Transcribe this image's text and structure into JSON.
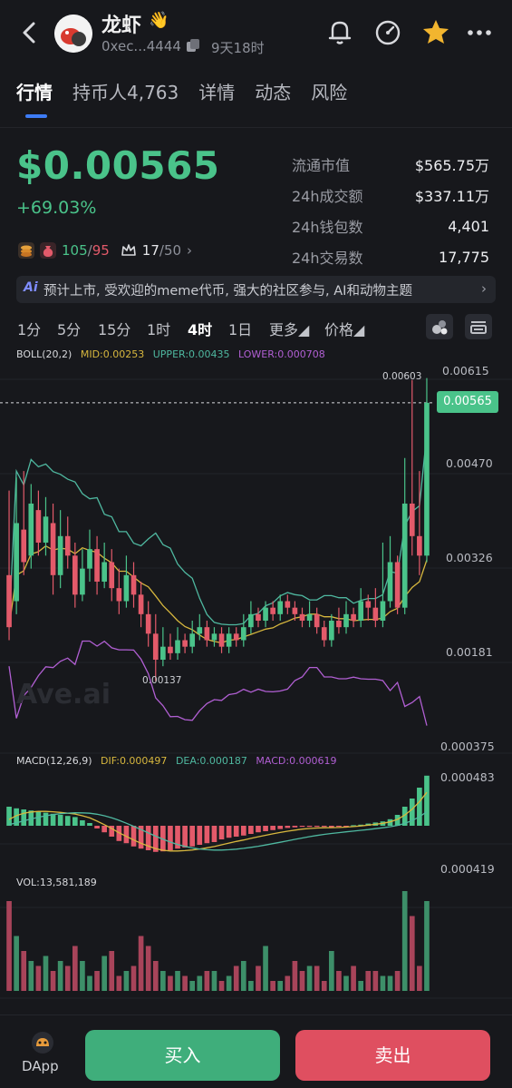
{
  "header": {
    "token_name": "龙虾",
    "wave_emoji": "👋",
    "address": "0xec...4444",
    "age": "9天18时",
    "icons": [
      "back-arrow-icon",
      "bell-icon",
      "speedometer-icon",
      "star-icon",
      "more-icon"
    ]
  },
  "tabs": [
    {
      "label": "行情",
      "active": true
    },
    {
      "label": "持币人4,763",
      "active": false
    },
    {
      "label": "详情",
      "active": false
    },
    {
      "label": "动态",
      "active": false
    },
    {
      "label": "风险",
      "active": false
    }
  ],
  "price": {
    "value": "$0.00565",
    "change": "+69.03%"
  },
  "stats": [
    {
      "label": "流通市值",
      "value": "$565.75万"
    },
    {
      "label": "24h成交额",
      "value": "$337.11万"
    },
    {
      "label": "24h钱包数",
      "value": "4,401"
    },
    {
      "label": "24h交易数",
      "value": "17,775"
    }
  ],
  "badges": {
    "bag_green": "105",
    "slash": "/",
    "bag_red": "95",
    "crown_value": "17",
    "crown_total": "/50",
    "chevron": "›"
  },
  "notice": {
    "ai_label": "Ai",
    "text": "预计上市, 受欢迎的meme代币, 强大的社区参与, AI和动物主题",
    "arrow": "›"
  },
  "timeframes": [
    {
      "label": "1分",
      "active": false
    },
    {
      "label": "5分",
      "active": false
    },
    {
      "label": "15分",
      "active": false
    },
    {
      "label": "1时",
      "active": false
    },
    {
      "label": "4时",
      "active": true
    },
    {
      "label": "1日",
      "active": false
    },
    {
      "label": "更多◢",
      "active": false
    },
    {
      "label": "价格◢",
      "active": false
    }
  ],
  "boll_legend": {
    "name": "BOLL(20,2)",
    "mid": "MID:0.00253",
    "upper": "UPPER:0.00435",
    "lower": "LOWER:0.000708"
  },
  "price_axis": [
    "0.00615",
    "0.00565",
    "0.00470",
    "0.00326",
    "0.00181",
    "0.000375"
  ],
  "low_label": "0.00137",
  "high_label": "0.00603",
  "watermark": "Ave.ai",
  "macd_legend": {
    "name": "MACD(12,26,9)",
    "dif": "DIF:0.000497",
    "dea": "DEA:0.000187",
    "macd": "MACD:0.000619"
  },
  "macd_axis": [
    "0.000483",
    "0.000419"
  ],
  "vol_legend": "VOL:13,581,189",
  "colors": {
    "up": "#4ac38a",
    "down": "#e35a6a",
    "mid": "#d7b73e",
    "upper": "#4fb8a0",
    "lower": "#b15fd3",
    "accent": "#3d7cf5"
  },
  "bottom": {
    "dapp_label": "DApp",
    "buy_label": "买入",
    "sell_label": "卖出"
  },
  "chart_data": {
    "type": "candlestick",
    "title": "",
    "ylim": [
      0.000375,
      0.00615
    ],
    "candles": [
      {
        "o": 0.003,
        "c": 0.0022,
        "h": 0.0043,
        "l": 0.002
      },
      {
        "o": 0.0026,
        "c": 0.0038,
        "h": 0.0045,
        "l": 0.0024
      },
      {
        "o": 0.0037,
        "c": 0.0032,
        "h": 0.0046,
        "l": 0.003
      },
      {
        "o": 0.0033,
        "c": 0.0041,
        "h": 0.0044,
        "l": 0.0031
      },
      {
        "o": 0.004,
        "c": 0.0035,
        "h": 0.0043,
        "l": 0.0033
      },
      {
        "o": 0.0035,
        "c": 0.0039,
        "h": 0.0042,
        "l": 0.0033
      },
      {
        "o": 0.0038,
        "c": 0.003,
        "h": 0.0041,
        "l": 0.0027
      },
      {
        "o": 0.003,
        "c": 0.0036,
        "h": 0.004,
        "l": 0.0028
      },
      {
        "o": 0.0036,
        "c": 0.0033,
        "h": 0.0039,
        "l": 0.0031
      },
      {
        "o": 0.0033,
        "c": 0.0027,
        "h": 0.0035,
        "l": 0.0025
      },
      {
        "o": 0.0027,
        "c": 0.0031,
        "h": 0.0034,
        "l": 0.0026
      },
      {
        "o": 0.0031,
        "c": 0.0034,
        "h": 0.0037,
        "l": 0.0029
      },
      {
        "o": 0.0034,
        "c": 0.0029,
        "h": 0.0036,
        "l": 0.0027
      },
      {
        "o": 0.0029,
        "c": 0.0032,
        "h": 0.0035,
        "l": 0.0028
      },
      {
        "o": 0.0032,
        "c": 0.0028,
        "h": 0.0034,
        "l": 0.0026
      },
      {
        "o": 0.0028,
        "c": 0.0026,
        "h": 0.0031,
        "l": 0.0024
      },
      {
        "o": 0.0026,
        "c": 0.003,
        "h": 0.0033,
        "l": 0.0025
      },
      {
        "o": 0.003,
        "c": 0.0027,
        "h": 0.0032,
        "l": 0.0025
      },
      {
        "o": 0.0027,
        "c": 0.0024,
        "h": 0.0029,
        "l": 0.0022
      },
      {
        "o": 0.0024,
        "c": 0.0021,
        "h": 0.0026,
        "l": 0.0019
      },
      {
        "o": 0.0021,
        "c": 0.0017,
        "h": 0.0024,
        "l": 0.00137
      },
      {
        "o": 0.0017,
        "c": 0.0019,
        "h": 0.0022,
        "l": 0.0016
      },
      {
        "o": 0.0019,
        "c": 0.0018,
        "h": 0.0021,
        "l": 0.0017
      },
      {
        "o": 0.0018,
        "c": 0.002,
        "h": 0.0022,
        "l": 0.0017
      },
      {
        "o": 0.002,
        "c": 0.0019,
        "h": 0.0021,
        "l": 0.0018
      },
      {
        "o": 0.0019,
        "c": 0.0021,
        "h": 0.0023,
        "l": 0.0018
      },
      {
        "o": 0.0021,
        "c": 0.0022,
        "h": 0.0024,
        "l": 0.002
      },
      {
        "o": 0.0022,
        "c": 0.002,
        "h": 0.0023,
        "l": 0.0019
      },
      {
        "o": 0.002,
        "c": 0.0021,
        "h": 0.0022,
        "l": 0.0019
      },
      {
        "o": 0.0021,
        "c": 0.0019,
        "h": 0.0022,
        "l": 0.0018
      },
      {
        "o": 0.0019,
        "c": 0.0021,
        "h": 0.0022,
        "l": 0.0018
      },
      {
        "o": 0.0021,
        "c": 0.002,
        "h": 0.0022,
        "l": 0.0019
      },
      {
        "o": 0.002,
        "c": 0.0022,
        "h": 0.0024,
        "l": 0.0019
      },
      {
        "o": 0.0022,
        "c": 0.0024,
        "h": 0.0026,
        "l": 0.0021
      },
      {
        "o": 0.0024,
        "c": 0.0023,
        "h": 0.0025,
        "l": 0.0022
      },
      {
        "o": 0.0023,
        "c": 0.0025,
        "h": 0.0026,
        "l": 0.0022
      },
      {
        "o": 0.0025,
        "c": 0.0024,
        "h": 0.0026,
        "l": 0.0023
      },
      {
        "o": 0.0024,
        "c": 0.0026,
        "h": 0.0027,
        "l": 0.0023
      },
      {
        "o": 0.0026,
        "c": 0.0025,
        "h": 0.0027,
        "l": 0.0024
      },
      {
        "o": 0.0025,
        "c": 0.0024,
        "h": 0.0026,
        "l": 0.0023
      },
      {
        "o": 0.0024,
        "c": 0.0023,
        "h": 0.0025,
        "l": 0.0022
      },
      {
        "o": 0.0023,
        "c": 0.0024,
        "h": 0.0026,
        "l": 0.0022
      },
      {
        "o": 0.0024,
        "c": 0.0022,
        "h": 0.0025,
        "l": 0.0021
      },
      {
        "o": 0.0022,
        "c": 0.002,
        "h": 0.0023,
        "l": 0.0019
      },
      {
        "o": 0.002,
        "c": 0.0023,
        "h": 0.0024,
        "l": 0.0019
      },
      {
        "o": 0.0023,
        "c": 0.0022,
        "h": 0.0025,
        "l": 0.0021
      },
      {
        "o": 0.0022,
        "c": 0.0024,
        "h": 0.0026,
        "l": 0.0021
      },
      {
        "o": 0.0024,
        "c": 0.0023,
        "h": 0.0025,
        "l": 0.0022
      },
      {
        "o": 0.0023,
        "c": 0.0026,
        "h": 0.0028,
        "l": 0.0022
      },
      {
        "o": 0.0026,
        "c": 0.0025,
        "h": 0.0027,
        "l": 0.0023
      },
      {
        "o": 0.0025,
        "c": 0.0023,
        "h": 0.0028,
        "l": 0.0022
      },
      {
        "o": 0.0023,
        "c": 0.0026,
        "h": 0.0035,
        "l": 0.0022
      },
      {
        "o": 0.0026,
        "c": 0.0032,
        "h": 0.0036,
        "l": 0.0025
      },
      {
        "o": 0.0032,
        "c": 0.0025,
        "h": 0.0033,
        "l": 0.0024
      },
      {
        "o": 0.0025,
        "c": 0.0041,
        "h": 0.0048,
        "l": 0.0024
      },
      {
        "o": 0.0041,
        "c": 0.0036,
        "h": 0.006,
        "l": 0.0033
      },
      {
        "o": 0.0036,
        "c": 0.0033,
        "h": 0.0046,
        "l": 0.003
      },
      {
        "o": 0.0033,
        "c": 0.00565,
        "h": 0.00603,
        "l": 0.0032
      }
    ],
    "volume": [
      0.9,
      0.55,
      0.4,
      0.3,
      0.25,
      0.35,
      0.2,
      0.3,
      0.25,
      0.45,
      0.3,
      0.15,
      0.2,
      0.35,
      0.4,
      0.15,
      0.2,
      0.25,
      0.55,
      0.45,
      0.3,
      0.2,
      0.15,
      0.2,
      0.15,
      0.1,
      0.15,
      0.2,
      0.2,
      0.1,
      0.15,
      0.25,
      0.3,
      0.1,
      0.25,
      0.45,
      0.1,
      0.1,
      0.15,
      0.3,
      0.2,
      0.25,
      0.25,
      0.1,
      0.4,
      0.2,
      0.15,
      0.25,
      0.1,
      0.2,
      0.2,
      0.15,
      0.15,
      0.2,
      1.0,
      0.75,
      0.25,
      0.9
    ],
    "macd_hist": [
      0.35,
      0.32,
      0.3,
      0.28,
      0.26,
      0.24,
      0.22,
      0.2,
      0.18,
      0.16,
      0.1,
      0.05,
      -0.05,
      -0.12,
      -0.2,
      -0.28,
      -0.32,
      -0.38,
      -0.42,
      -0.45,
      -0.48,
      -0.47,
      -0.45,
      -0.42,
      -0.4,
      -0.38,
      -0.35,
      -0.32,
      -0.3,
      -0.25,
      -0.22,
      -0.2,
      -0.18,
      -0.15,
      -0.12,
      -0.1,
      -0.08,
      -0.06,
      -0.04,
      -0.03,
      -0.02,
      -0.02,
      -0.02,
      -0.02,
      -0.03,
      -0.02,
      -0.01,
      0.01,
      0.02,
      0.04,
      0.06,
      0.08,
      0.12,
      0.2,
      0.35,
      0.5,
      0.7,
      0.92
    ]
  }
}
